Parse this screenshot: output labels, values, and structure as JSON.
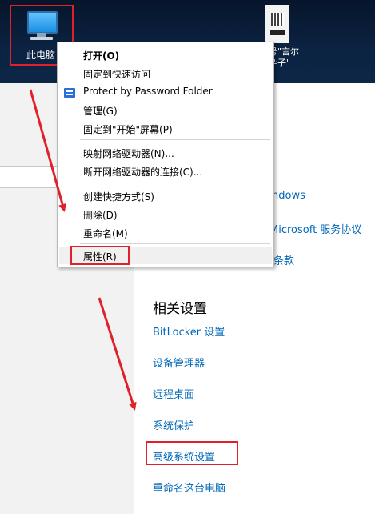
{
  "desktop": {
    "this_pc_label": "此电脑",
    "qr_label_line1": "号\"言尔",
    "qr_label_line2": "卆子\""
  },
  "context_menu": {
    "items": [
      {
        "label": "打开(O)",
        "bold": true
      },
      {
        "label": "固定到快速访问"
      },
      {
        "label": "Protect by Password Folder"
      },
      {
        "label": "管理(G)"
      },
      {
        "label": "固定到\"开始\"屏幕(P)"
      },
      {
        "label": "映射网络驱动器(N)..."
      },
      {
        "label": "断开网络驱动器的连接(C)..."
      },
      {
        "label": "创建快捷方式(S)"
      },
      {
        "label": "删除(D)"
      },
      {
        "label": "重命名(M)"
      },
      {
        "label": "属性(R)",
        "highlighted": true
      }
    ]
  },
  "settings": {
    "partial_links": [
      "ndows",
      "Microsoft 服务协议",
      "条款"
    ],
    "related_title": "相关设置",
    "related_links": [
      "BitLocker 设置",
      "设备管理器",
      "远程桌面",
      "系统保护",
      "高级系统设置",
      "重命名这台电脑"
    ]
  },
  "colors": {
    "annotation_red": "#e0202a",
    "link_blue": "#0067b8"
  }
}
